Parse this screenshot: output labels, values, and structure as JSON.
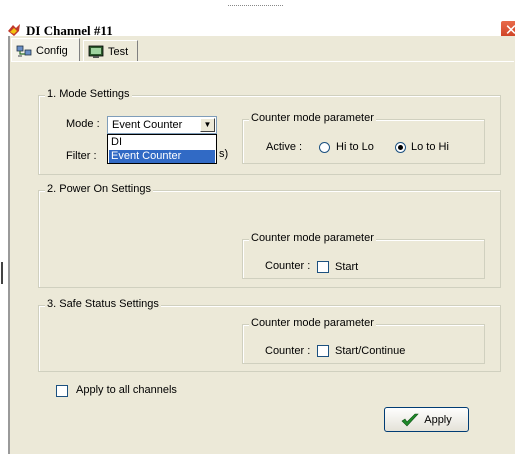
{
  "window": {
    "title": "DI Channel #11",
    "close_glyph": "✕"
  },
  "tabs": [
    {
      "label": "Config",
      "icon": "network-icon",
      "active": true
    },
    {
      "label": "Test",
      "icon": "monitor-icon",
      "active": false
    }
  ],
  "mode_settings": {
    "legend": "1. Mode Settings",
    "mode_label": "Mode :",
    "mode_value": "Event Counter",
    "dropdown_options": [
      "DI",
      "Event Counter"
    ],
    "dropdown_selected": "Event Counter",
    "filter_label": "Filter :",
    "filter_partial_suffix": "s)",
    "counter_param": {
      "legend": "Counter mode parameter",
      "active_label": "Active :",
      "options": [
        "Hi to Lo",
        "Lo to Hi"
      ],
      "selected": "Lo to Hi"
    }
  },
  "power_on": {
    "legend": "2. Power On Settings",
    "counter_param": {
      "legend": "Counter mode parameter",
      "counter_label": "Counter :",
      "checkbox_label": "Start",
      "checked": false
    }
  },
  "safe_status": {
    "legend": "3. Safe Status Settings",
    "counter_param": {
      "legend": "Counter mode parameter",
      "counter_label": "Counter :",
      "checkbox_label": "Start/Continue",
      "checked": false
    }
  },
  "apply_all": {
    "label": "Apply to all channels",
    "checked": false
  },
  "apply_button": {
    "label": "Apply",
    "icon": "checkmark-icon"
  },
  "colors": {
    "face": "#ece9d8",
    "selection": "#316ac5",
    "close": "#d4502f"
  }
}
